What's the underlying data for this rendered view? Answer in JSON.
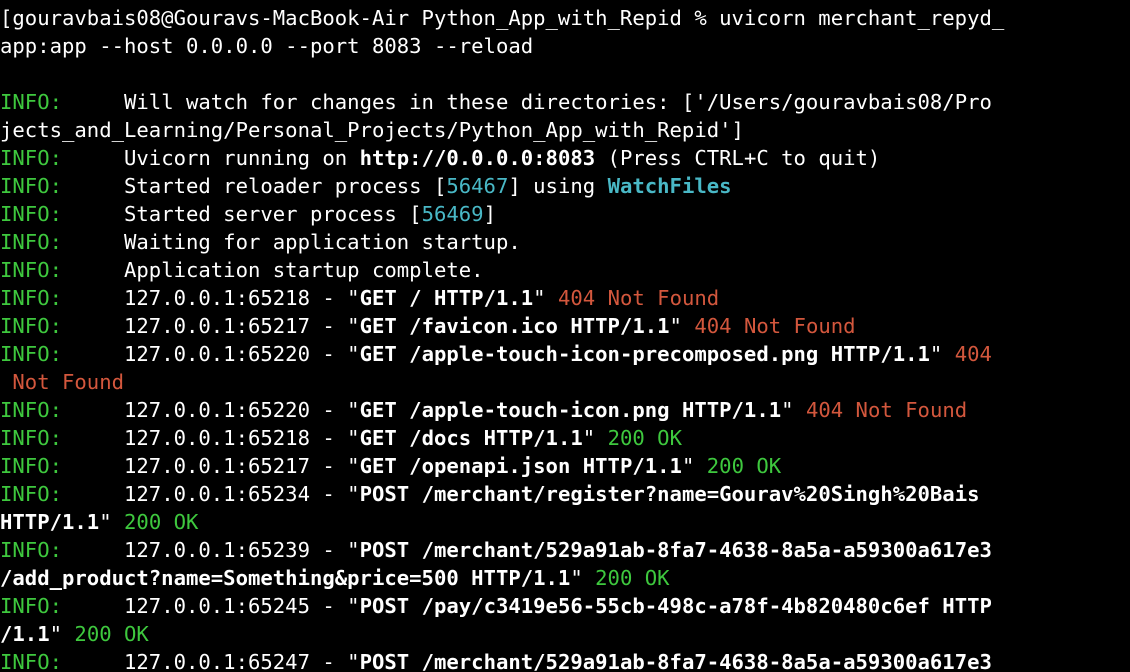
{
  "terminal": {
    "lines": [
      {
        "segments": [
          {
            "text": "[gouravbais08@Gouravs-MacBook-Air Python_App_with_Repid % uvicorn merchant_repyd_",
            "style": "plain"
          }
        ]
      },
      {
        "segments": [
          {
            "text": "app:app --host 0.0.0.0 --port 8083 --reload",
            "style": "plain"
          }
        ]
      },
      {
        "segments": [
          {
            "text": "",
            "style": "plain"
          }
        ]
      },
      {
        "segments": [
          {
            "text": "INFO:",
            "style": "info"
          },
          {
            "text": "     Will watch for changes in these directories: ['/Users/gouravbais08/Pro",
            "style": "plain"
          }
        ]
      },
      {
        "segments": [
          {
            "text": "jects_and_Learning/Personal_Projects/Python_App_with_Repid']",
            "style": "plain"
          }
        ]
      },
      {
        "segments": [
          {
            "text": "INFO:",
            "style": "info"
          },
          {
            "text": "     Uvicorn running on ",
            "style": "plain"
          },
          {
            "text": "http://0.0.0.0:8083",
            "style": "bold"
          },
          {
            "text": " (Press CTRL+C to quit)",
            "style": "plain"
          }
        ]
      },
      {
        "segments": [
          {
            "text": "INFO:",
            "style": "info"
          },
          {
            "text": "     Started reloader process [",
            "style": "plain"
          },
          {
            "text": "56467",
            "style": "num"
          },
          {
            "text": "] using ",
            "style": "plain"
          },
          {
            "text": "WatchFiles",
            "style": "watch"
          }
        ]
      },
      {
        "segments": [
          {
            "text": "INFO:",
            "style": "info"
          },
          {
            "text": "     Started server process [",
            "style": "plain"
          },
          {
            "text": "56469",
            "style": "num"
          },
          {
            "text": "]",
            "style": "plain"
          }
        ]
      },
      {
        "segments": [
          {
            "text": "INFO:",
            "style": "info"
          },
          {
            "text": "     Waiting for application startup.",
            "style": "plain"
          }
        ]
      },
      {
        "segments": [
          {
            "text": "INFO:",
            "style": "info"
          },
          {
            "text": "     Application startup complete.",
            "style": "plain"
          }
        ]
      },
      {
        "segments": [
          {
            "text": "INFO:",
            "style": "info"
          },
          {
            "text": "     127.0.0.1:65218 - \"",
            "style": "plain"
          },
          {
            "text": "GET / HTTP/1.1",
            "style": "bold"
          },
          {
            "text": "\" ",
            "style": "plain"
          },
          {
            "text": "404 Not Found",
            "style": "err"
          }
        ]
      },
      {
        "segments": [
          {
            "text": "INFO:",
            "style": "info"
          },
          {
            "text": "     127.0.0.1:65217 - \"",
            "style": "plain"
          },
          {
            "text": "GET /favicon.ico HTTP/1.1",
            "style": "bold"
          },
          {
            "text": "\" ",
            "style": "plain"
          },
          {
            "text": "404 Not Found",
            "style": "err"
          }
        ]
      },
      {
        "segments": [
          {
            "text": "INFO:",
            "style": "info"
          },
          {
            "text": "     127.0.0.1:65220 - \"",
            "style": "plain"
          },
          {
            "text": "GET /apple-touch-icon-precomposed.png HTTP/1.1",
            "style": "bold"
          },
          {
            "text": "\" ",
            "style": "plain"
          },
          {
            "text": "404",
            "style": "err"
          }
        ]
      },
      {
        "segments": [
          {
            "text": " Not Found",
            "style": "err"
          }
        ]
      },
      {
        "segments": [
          {
            "text": "INFO:",
            "style": "info"
          },
          {
            "text": "     127.0.0.1:65220 - \"",
            "style": "plain"
          },
          {
            "text": "GET /apple-touch-icon.png HTTP/1.1",
            "style": "bold"
          },
          {
            "text": "\" ",
            "style": "plain"
          },
          {
            "text": "404 Not Found",
            "style": "err"
          }
        ]
      },
      {
        "segments": [
          {
            "text": "INFO:",
            "style": "info"
          },
          {
            "text": "     127.0.0.1:65218 - \"",
            "style": "plain"
          },
          {
            "text": "GET /docs HTTP/1.1",
            "style": "bold"
          },
          {
            "text": "\" ",
            "style": "plain"
          },
          {
            "text": "200 OK",
            "style": "ok"
          }
        ]
      },
      {
        "segments": [
          {
            "text": "INFO:",
            "style": "info"
          },
          {
            "text": "     127.0.0.1:65217 - \"",
            "style": "plain"
          },
          {
            "text": "GET /openapi.json HTTP/1.1",
            "style": "bold"
          },
          {
            "text": "\" ",
            "style": "plain"
          },
          {
            "text": "200 OK",
            "style": "ok"
          }
        ]
      },
      {
        "segments": [
          {
            "text": "INFO:",
            "style": "info"
          },
          {
            "text": "     127.0.0.1:65234 - \"",
            "style": "plain"
          },
          {
            "text": "POST /merchant/register?name=Gourav%20Singh%20Bais",
            "style": "bold"
          }
        ]
      },
      {
        "segments": [
          {
            "text": "HTTP/1.1",
            "style": "bold"
          },
          {
            "text": "\" ",
            "style": "plain"
          },
          {
            "text": "200 OK",
            "style": "ok"
          }
        ]
      },
      {
        "segments": [
          {
            "text": "INFO:",
            "style": "info"
          },
          {
            "text": "     127.0.0.1:65239 - \"",
            "style": "plain"
          },
          {
            "text": "POST /merchant/529a91ab-8fa7-4638-8a5a-a59300a617e3",
            "style": "bold"
          }
        ]
      },
      {
        "segments": [
          {
            "text": "/add_product?name=Something&price=500 HTTP/1.1",
            "style": "bold"
          },
          {
            "text": "\" ",
            "style": "plain"
          },
          {
            "text": "200 OK",
            "style": "ok"
          }
        ]
      },
      {
        "segments": [
          {
            "text": "INFO:",
            "style": "info"
          },
          {
            "text": "     127.0.0.1:65245 - \"",
            "style": "plain"
          },
          {
            "text": "POST /pay/c3419e56-55cb-498c-a78f-4b820480c6ef HTTP",
            "style": "bold"
          }
        ]
      },
      {
        "segments": [
          {
            "text": "/1.1",
            "style": "bold"
          },
          {
            "text": "\" ",
            "style": "plain"
          },
          {
            "text": "200 OK",
            "style": "ok"
          }
        ]
      },
      {
        "segments": [
          {
            "text": "INFO:",
            "style": "info"
          },
          {
            "text": "     127.0.0.1:65247 - \"",
            "style": "plain"
          },
          {
            "text": "POST /merchant/529a91ab-8fa7-4638-8a5a-a59300a617e3",
            "style": "bold"
          }
        ]
      }
    ]
  },
  "colors": {
    "background": "#000000",
    "foreground": "#ffffff",
    "info": "#3ec83e",
    "number": "#49b8c6",
    "error": "#d3573d",
    "ok": "#3ec83e"
  }
}
